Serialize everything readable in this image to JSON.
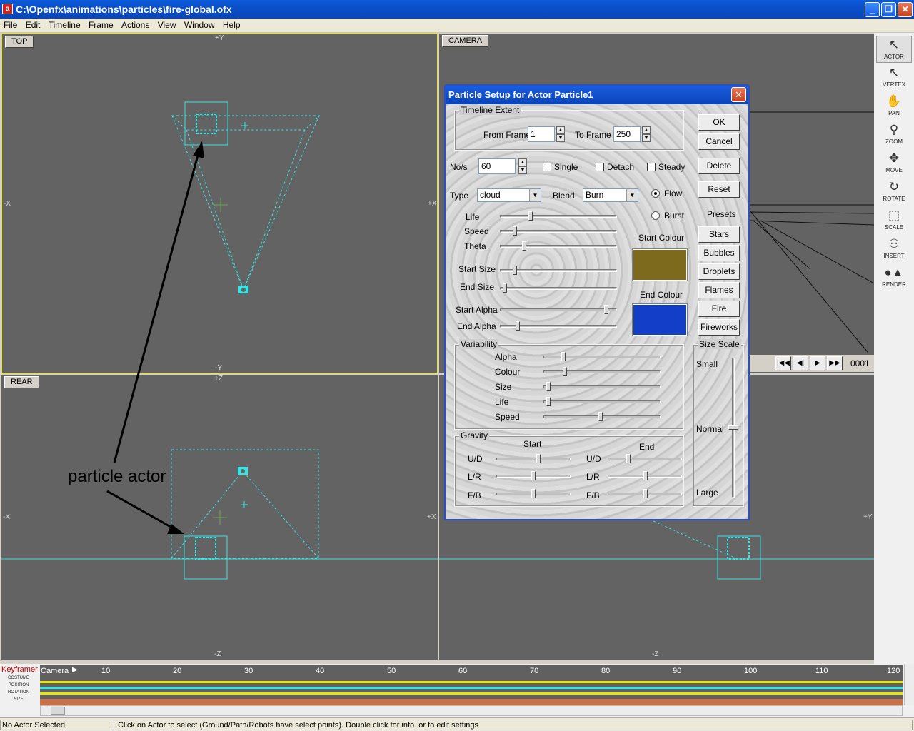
{
  "window": {
    "title": "C:\\Openfx\\animations\\particles\\fire-global.ofx",
    "app_icon": "openfx-icon"
  },
  "menu": [
    "File",
    "Edit",
    "Timeline",
    "Frame",
    "Actions",
    "View",
    "Window",
    "Help"
  ],
  "viewports": {
    "top": {
      "label": "TOP",
      "axis_top": "+Y",
      "axis_bottom": "-Y",
      "axis_left": "-X",
      "axis_right": "+X"
    },
    "rear": {
      "label": "REAR",
      "axis_top": "+Z",
      "axis_bottom": "-Z",
      "axis_left": "-X",
      "axis_right": "+X"
    },
    "camera": {
      "label": "CAMERA"
    },
    "side": {
      "axis_bottom": "-Z",
      "axis_right": "+Y"
    }
  },
  "annotation": {
    "text": "particle actor"
  },
  "toolbar": [
    {
      "label": "ACTOR",
      "icon": "pointer-icon",
      "key": "O"
    },
    {
      "label": "VERTEX",
      "icon": "vertex-pointer-icon",
      "key": "V"
    },
    {
      "label": "PAN",
      "icon": "hand-icon",
      "key": "P"
    },
    {
      "label": "ZOOM",
      "icon": "magnifier-icon",
      "key": "Z"
    },
    {
      "label": "MOVE",
      "icon": "move-arrows-icon",
      "key": "M"
    },
    {
      "label": "ROTATE",
      "icon": "rotate-icon",
      "key": "R"
    },
    {
      "label": "SCALE",
      "icon": "scale-icon",
      "key": "S"
    },
    {
      "label": "INSERT",
      "icon": "insert-icon",
      "key": ""
    },
    {
      "label": "RENDER",
      "icon": "render-spheres-icon",
      "key": ""
    }
  ],
  "playback": {
    "frame": "0001",
    "buttons": [
      "|◀◀",
      "◀|",
      "▶",
      "▶▶"
    ]
  },
  "dialog": {
    "title": "Particle Setup for Actor Particle1",
    "timeline_extent": {
      "title": "Timeline Extent",
      "from_label": "From Frame",
      "from_value": "1",
      "to_label": "To Frame",
      "to_value": "250"
    },
    "nos": {
      "label": "No/s",
      "value": "60"
    },
    "checks": [
      {
        "label": "Single",
        "checked": false
      },
      {
        "label": "Detach",
        "checked": false
      },
      {
        "label": "Steady",
        "checked": false
      }
    ],
    "type": {
      "label": "Type",
      "value": "cloud"
    },
    "blend": {
      "label": "Blend",
      "value": "Burn"
    },
    "mode": {
      "flow_label": "Flow",
      "burst_label": "Burst",
      "selected": "Flow"
    },
    "sliders": [
      {
        "label": "Life",
        "value": 0.26
      },
      {
        "label": "Speed",
        "value": 0.13
      },
      {
        "label": "Theta",
        "value": 0.21
      },
      {
        "label": "Start Size",
        "value": 0.13
      },
      {
        "label": "End Size",
        "value": 0.04
      },
      {
        "label": "Start Alpha",
        "value": 0.91
      },
      {
        "label": "End Alpha",
        "value": 0.15
      }
    ],
    "start_colour": {
      "label": "Start Colour",
      "color": "#7d6a1c"
    },
    "end_colour": {
      "label": "End Colour",
      "color": "#123ec8"
    },
    "variability": {
      "title": "Variability",
      "items": [
        {
          "label": "Alpha",
          "value": 0.17
        },
        {
          "label": "Colour",
          "value": 0.18
        },
        {
          "label": "Size",
          "value": 0.04
        },
        {
          "label": "Life",
          "value": 0.04
        },
        {
          "label": "Speed",
          "value": 0.49
        }
      ]
    },
    "gravity": {
      "title": "Gravity",
      "start_label": "Start",
      "end_label": "End",
      "rows": [
        {
          "label": "U/D",
          "start": 0.57,
          "end": 0.28
        },
        {
          "label": "L/R",
          "start": 0.5,
          "end": 0.51
        },
        {
          "label": "F/B",
          "start": 0.5,
          "end": 0.51
        }
      ]
    },
    "size_scale": {
      "title": "Size Scale",
      "small": "Small",
      "normal": "Normal",
      "large": "Large",
      "value": 0.5
    },
    "buttons": {
      "ok": "OK",
      "cancel": "Cancel",
      "delete": "Delete",
      "reset": "Reset"
    },
    "presets": {
      "label": "Presets",
      "items": [
        "Stars",
        "Bubbles",
        "Droplets",
        "Flames",
        "Fire",
        "Fireworks"
      ]
    }
  },
  "timeline": {
    "label": "Keyframer",
    "track_labels": [
      "COSTUME",
      "POSITION",
      "ROTATION",
      "SIZE"
    ],
    "camera_label": "Camera",
    "ticks": [
      "10",
      "20",
      "30",
      "40",
      "50",
      "60",
      "70",
      "80",
      "90",
      "100",
      "110",
      "120"
    ]
  },
  "status": {
    "left": "No Actor Selected",
    "right": "Click on Actor to select  (Ground/Path/Robots have select points). Double click for info. or to edit settings"
  },
  "colors": {
    "wire": "#33e6e6",
    "viewport_bg": "#636363",
    "highlight_border": "#e6e600"
  }
}
